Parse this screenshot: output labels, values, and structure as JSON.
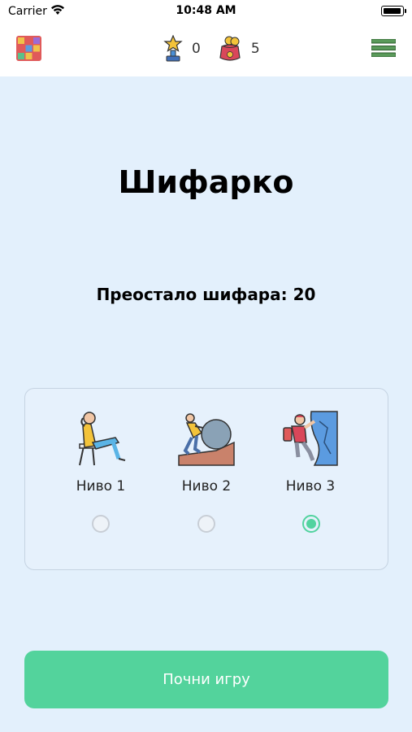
{
  "status_bar": {
    "carrier": "Carrier",
    "time": "10:48 AM"
  },
  "header": {
    "trophy_count": "0",
    "coins_count": "5"
  },
  "main": {
    "title": "Шифарко",
    "remaining": "Преостало шифара: 20"
  },
  "levels": [
    {
      "label": "Ниво 1",
      "selected": false
    },
    {
      "label": "Ниво 2",
      "selected": false
    },
    {
      "label": "Ниво 3",
      "selected": true
    }
  ],
  "start_button": {
    "label": "Почни игру"
  },
  "colors": {
    "accent": "#53d39c",
    "background": "#e3f0fc"
  }
}
